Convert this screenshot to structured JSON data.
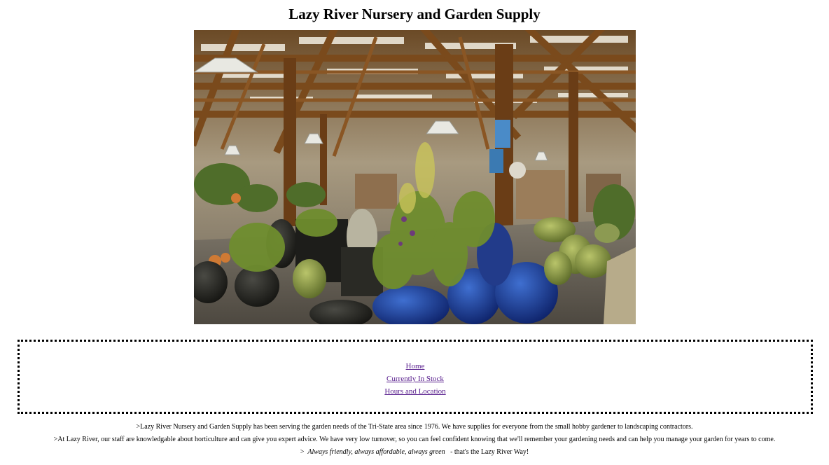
{
  "header": {
    "title": "Lazy River Nursery and Garden Supply"
  },
  "hero": {
    "image_subject": "greenhouse-interior-with-pots-and-plants"
  },
  "nav": {
    "items": [
      {
        "label": "Home"
      },
      {
        "label": "Currently In Stock"
      },
      {
        "label": "Hours and Location"
      }
    ],
    "link_color": "#551a8b"
  },
  "about": {
    "line1": ">Lazy River Nursery and Garden Supply has been serving the garden needs of the Tri-State area since 1976. We have supplies for everyone from the small hobby gardener to landscaping contractors.",
    "line2": ">At Lazy River, our staff are knowledgable about horticulture and can give you expert advice. We have very low turnover, so you can feel confident knowing that we'll remember your gardening needs and can help you manage your garden for years to come.",
    "line3_prefix": ">",
    "line3_slogan": "Always friendly, always affordable, always green",
    "line3_suffix": " - that's the Lazy River Way!"
  }
}
